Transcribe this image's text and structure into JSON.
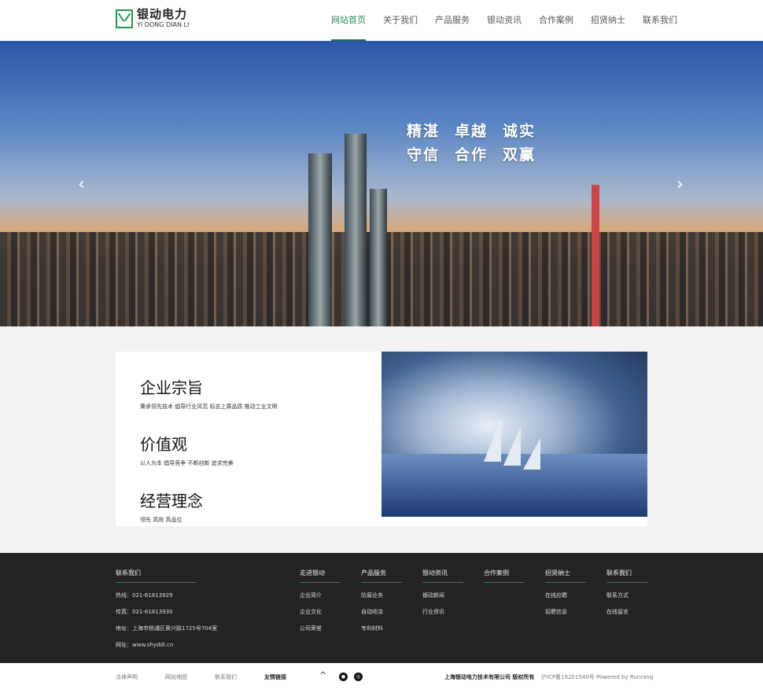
{
  "header": {
    "logo_cn": "银动电力",
    "logo_en": "YI DONG DIAN LI",
    "nav": [
      "网站首页",
      "关于我们",
      "产品服务",
      "银动资讯",
      "合作案例",
      "招贤纳士",
      "联系我们"
    ],
    "active_index": 0,
    "accent": "#1f8a55"
  },
  "hero": {
    "slogan_row1": [
      "精湛",
      "卓越",
      "诚实"
    ],
    "slogan_row2": [
      "守信",
      "合作",
      "双赢"
    ],
    "prev_icon": "‹",
    "next_icon": "›"
  },
  "about": {
    "items": [
      {
        "title": "企业宗旨",
        "desc": "秉承领先技术 倡导行业风范 标志上乘品质 推动工业文明"
      },
      {
        "title": "价值观",
        "desc": "以人为本 倡导竞争 不断创新 追求完美"
      },
      {
        "title": "经营理念",
        "desc": "领先 高效 高品位"
      }
    ]
  },
  "footer": {
    "contact": {
      "title": "联系我们",
      "lines": [
        "热线：021-61813929",
        "传真：021-61813930",
        "地址：上海市杨浦区黄兴路1725号704室",
        "网址：www.shyddl.cn"
      ]
    },
    "columns": [
      {
        "title": "走进银动",
        "links": [
          "企业简介",
          "企业文化",
          "公司荣誉"
        ]
      },
      {
        "title": "产品服务",
        "links": [
          "防腐业务",
          "自动喷涂",
          "专利材料"
        ]
      },
      {
        "title": "银动资讯",
        "links": [
          "银动新闻",
          "行业资讯"
        ]
      },
      {
        "title": "合作案例",
        "links": []
      },
      {
        "title": "招贤纳士",
        "links": [
          "在线应聘",
          "招聘信息"
        ]
      },
      {
        "title": "联系我们",
        "links": [
          "联系方式",
          "在线留言"
        ]
      }
    ]
  },
  "bottom": {
    "links": [
      "法律声明",
      "网站地图",
      "联系我们"
    ],
    "friend_links": "友情链接",
    "up_icon": "^",
    "wechat_icon": "wechat-icon",
    "weibo_icon": "weibo-icon",
    "company": "上海银动电力技术有限公司 版权所有",
    "icp": "沪ICP备19201540号 Powered by Runrang"
  }
}
